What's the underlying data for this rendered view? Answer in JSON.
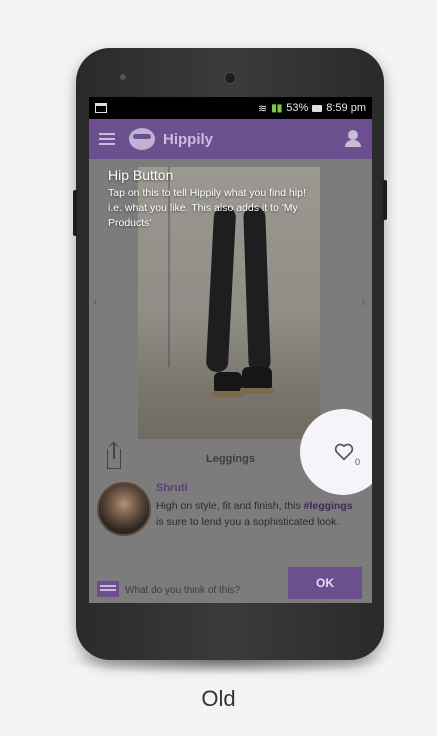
{
  "status_bar": {
    "battery": "53%",
    "time": "8:59 pm"
  },
  "app_bar": {
    "title": "Hippily",
    "menu_icon": "hamburger-menu-icon",
    "logo_icon": "hippily-logo-icon",
    "profile_icon": "user-profile-icon",
    "bg_color": "#6c4f8f"
  },
  "tooltip": {
    "title": "Hip Button",
    "body": "Tap on this to tell Hippily what you find hip! i.e. what you like. This also adds it to 'My Products'"
  },
  "item": {
    "name": "Leggings",
    "like_count": "0",
    "share_icon": "share-icon",
    "heart_icon": "heart-outline-icon"
  },
  "comment": {
    "author": "Shruti",
    "text_before": "High on style, fit and finish, this ",
    "hashtag": "#leggings",
    "text_after": " is sure to lend you a sophisticated look."
  },
  "input": {
    "placeholder": "What do you think of this?",
    "ok_label": "OK"
  },
  "caption": "Old"
}
